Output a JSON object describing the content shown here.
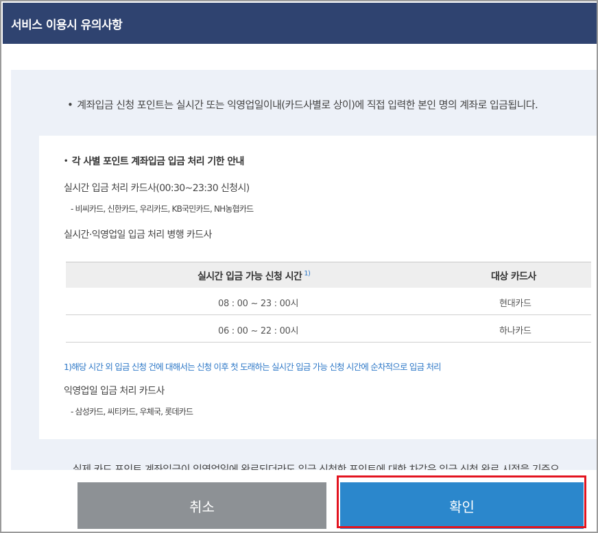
{
  "dialog": {
    "title": "서비스 이용시 유의사항"
  },
  "notice": {
    "bullet": "•",
    "text": "계좌입금 신청 포인트는 실시간 또는 익영업일이내(카드사별로 상이)에 직접 입력한 본인 명의 계좌로 입금됩니다."
  },
  "card": {
    "section_bullet": "•",
    "section_title": "각 사별 포인트 계좌입금 입금 처리 기한 안내",
    "realtime_title": "실시간 입금 처리 카드사(00:30~23:30 신청시)",
    "realtime_cards": "- 비씨카드, 신한카드, 우리카드, KB국민카드, NH농협카드",
    "parallel_title": "실시간·익영업일 입금 처리 병행 카드사",
    "table": {
      "headers": [
        "실시간 입금 가능 신청 시간",
        "대상 카드사"
      ],
      "header_footnote_mark": "1)",
      "rows": [
        [
          "08 : 00 ~ 23 : 00시",
          "현대카드"
        ],
        [
          "06 : 00 ~ 22 : 00시",
          "하나카드"
        ]
      ]
    },
    "footnote": "1)해당 시간 외 입금 신청 건에 대해서는 신청 이후 첫 도래하는 실시간 입금 가능 신청 시간에 순차적으로 입금 처리",
    "nextday_title": "익영업일 입금 처리 카드사",
    "nextday_cards": "- 삼성카드, 씨티카드, 우체국, 롯데카드"
  },
  "partial_text": "실제 카드 포인트 계좌입금이 익영업일에 완료되더라도 입금 신청한 포인트에 대한 차감은 입금 신청 완료 시점을 기준으",
  "buttons": {
    "cancel": "취소",
    "confirm": "확인"
  },
  "colors": {
    "header_bg": "#2f4370",
    "confirm_bg": "#2b87cc",
    "cancel_bg": "#8d9195",
    "highlight_border": "#e3141f",
    "footnote_text": "#2e78c7"
  }
}
